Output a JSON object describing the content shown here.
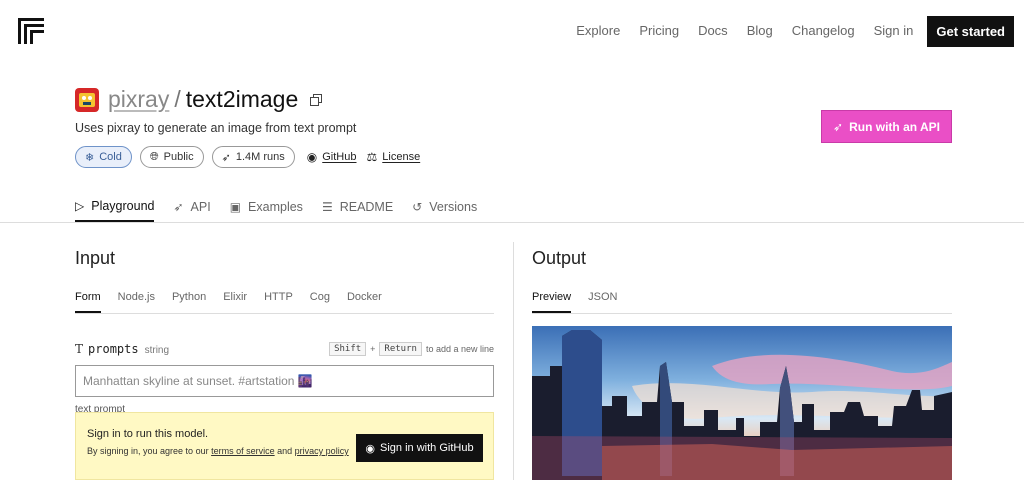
{
  "nav": {
    "links": [
      "Explore",
      "Pricing",
      "Docs",
      "Blog",
      "Changelog",
      "Sign in"
    ],
    "cta": "Get started"
  },
  "model": {
    "owner": "pixray",
    "separator": "/",
    "name": "text2image",
    "description": "Uses pixray to generate an image from text prompt"
  },
  "badges": {
    "cold": "Cold",
    "public": "Public",
    "runs": "1.4M runs",
    "github": "GitHub",
    "license": "License"
  },
  "api_button": "Run with an API",
  "tabs": [
    "Playground",
    "API",
    "Examples",
    "README",
    "Versions"
  ],
  "input": {
    "title": "Input",
    "subtabs": [
      "Form",
      "Node.js",
      "Python",
      "Elixir",
      "HTTP",
      "Cog",
      "Docker"
    ],
    "field": {
      "icon": "T",
      "name": "prompts",
      "type": "string",
      "hint_key1": "Shift",
      "hint_plus": "+",
      "hint_key2": "Return",
      "hint_text": "to add a new line",
      "placeholder": "Manhattan skyline at sunset. #artstation 🌆",
      "help": "text prompt"
    },
    "signin": {
      "title": "Sign in to run this model.",
      "desc_prefix": "By signing in, you agree to our",
      "terms": "terms of service",
      "and": "and",
      "privacy": "privacy policy",
      "button": "Sign in with GitHub"
    }
  },
  "output": {
    "title": "Output",
    "subtabs": [
      "Preview",
      "JSON"
    ]
  },
  "colors": {
    "api_button": "#ea4fc6",
    "cold_badge": "#e9effa",
    "signin_bg": "#fff9c4"
  }
}
